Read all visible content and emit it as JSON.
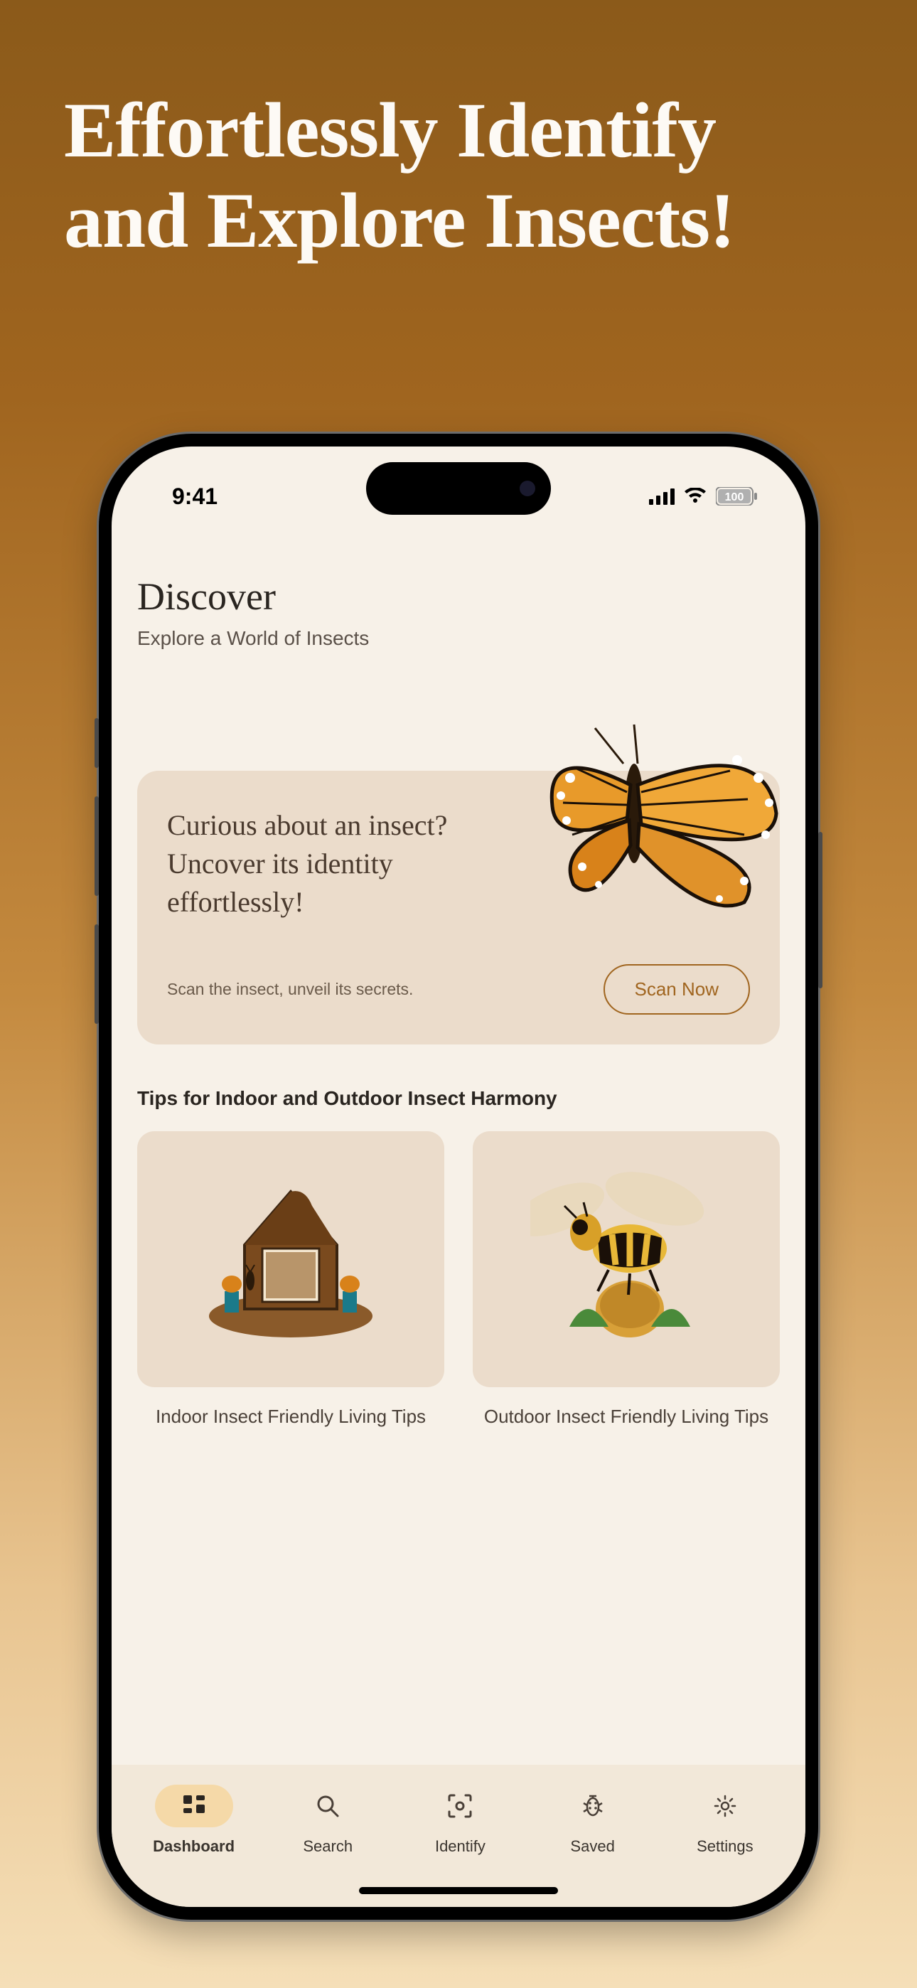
{
  "promo": {
    "headline": "Effortlessly Identify and Explore Insects!"
  },
  "status": {
    "time": "9:41",
    "battery": "100"
  },
  "page": {
    "title": "Discover",
    "subtitle": "Explore a World of Insects"
  },
  "hero": {
    "title": "Curious about an insect? Uncover its identity effortlessly!",
    "subtitle": "Scan the insect, unveil its secrets.",
    "cta": "Scan Now"
  },
  "tips": {
    "section_title": "Tips for Indoor and Outdoor Insect Harmony",
    "cards": [
      {
        "label": "Indoor Insect Friendly Living Tips"
      },
      {
        "label": "Outdoor Insect Friendly Living Tips"
      }
    ]
  },
  "nav": {
    "items": [
      {
        "label": "Dashboard"
      },
      {
        "label": "Search"
      },
      {
        "label": "Identify"
      },
      {
        "label": "Saved"
      },
      {
        "label": "Settings"
      }
    ]
  }
}
